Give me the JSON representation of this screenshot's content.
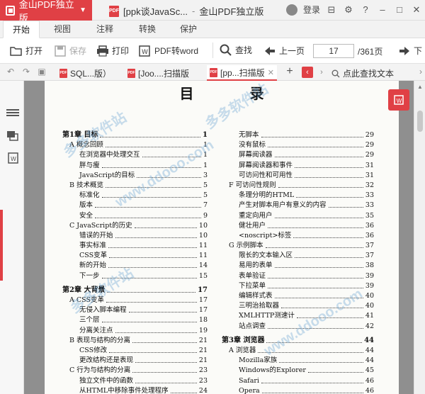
{
  "app": {
    "name": "金山PDF独立版",
    "doc_title": "[ppk谈JavaSc...",
    "window_title": "金山PDF独立版",
    "login": "登录"
  },
  "menu": [
    "开始",
    "视图",
    "注释",
    "转换",
    "保护"
  ],
  "toolbar": {
    "open": "打开",
    "save": "保存",
    "print": "打印",
    "pdf_to_word": "PDF转word",
    "find": "查找",
    "prev": "上一页",
    "page_current": "17",
    "page_total": "/361页",
    "next": "下"
  },
  "doc_tabs": [
    {
      "label": "SQL...版）"
    },
    {
      "label": "[Joo....扫描版"
    },
    {
      "label": "[pp...扫描版"
    }
  ],
  "click_find_text": "点此查找文本",
  "page": {
    "title": "目 录",
    "left_column": [
      {
        "text": "第1章  目标",
        "page": "1",
        "level": 0
      },
      {
        "text": "A  概念回顾",
        "page": "1",
        "level": 1
      },
      {
        "text": "在浏览器中处理交互",
        "page": "1",
        "level": 2
      },
      {
        "text": "胖与瘦",
        "page": "1",
        "level": 2
      },
      {
        "text": "JavaScript的目标",
        "page": "3",
        "level": 2
      },
      {
        "text": "B  技术概览",
        "page": "5",
        "level": 1
      },
      {
        "text": "标准化",
        "page": "5",
        "level": 2
      },
      {
        "text": "版本",
        "page": "7",
        "level": 2
      },
      {
        "text": "安全",
        "page": "9",
        "level": 2
      },
      {
        "text": "C  JavaScript的历史",
        "page": "10",
        "level": 1
      },
      {
        "text": "错误的开始",
        "page": "10",
        "level": 2
      },
      {
        "text": "事实标准",
        "page": "11",
        "level": 2
      },
      {
        "text": "CSS变革",
        "page": "11",
        "level": 2
      },
      {
        "text": "新的开始",
        "page": "14",
        "level": 2
      },
      {
        "text": "下一步",
        "page": "15",
        "level": 2
      },
      {
        "text": "第2章  大背景",
        "page": "17",
        "level": 0
      },
      {
        "text": "A  CSS变革",
        "page": "17",
        "level": 1
      },
      {
        "text": "无侵入脚本编程",
        "page": "17",
        "level": 2
      },
      {
        "text": "三个层",
        "page": "18",
        "level": 2
      },
      {
        "text": "分离关注点",
        "page": "19",
        "level": 2
      },
      {
        "text": "B  表现与结构的分离",
        "page": "21",
        "level": 1
      },
      {
        "text": "CSS修改",
        "page": "21",
        "level": 2
      },
      {
        "text": "更改结构还是表现",
        "page": "21",
        "level": 2
      },
      {
        "text": "C  行为与结构的分离",
        "page": "23",
        "level": 1
      },
      {
        "text": "独立文件中的函数",
        "page": "23",
        "level": 2
      },
      {
        "text": "从HTML中移除事件处理程序",
        "page": "24",
        "level": 2
      }
    ],
    "right_column": [
      {
        "text": "无脚本",
        "page": "29",
        "level": 2
      },
      {
        "text": "没有鼠标",
        "page": "29",
        "level": 2
      },
      {
        "text": "屏幕阅读器",
        "page": "29",
        "level": 2
      },
      {
        "text": "屏幕阅读器和事件",
        "page": "31",
        "level": 2
      },
      {
        "text": "可访问性和可用性",
        "page": "31",
        "level": 2
      },
      {
        "text": "F  可访问性规则",
        "page": "32",
        "level": 1
      },
      {
        "text": "条理分明的HTML",
        "page": "33",
        "level": 2
      },
      {
        "text": "产生对脚本用户有意义的内容",
        "page": "33",
        "level": 2
      },
      {
        "text": "重定向用户",
        "page": "35",
        "level": 2
      },
      {
        "text": "健壮用户",
        "page": "36",
        "level": 2
      },
      {
        "text": "<noscript>标签",
        "page": "36",
        "level": 2
      },
      {
        "text": "G  示例脚本",
        "page": "37",
        "level": 1
      },
      {
        "text": "限长的文本输入区",
        "page": "37",
        "level": 2
      },
      {
        "text": "易用的表单",
        "page": "38",
        "level": 2
      },
      {
        "text": "表单验证",
        "page": "39",
        "level": 2
      },
      {
        "text": "下拉菜单",
        "page": "39",
        "level": 2
      },
      {
        "text": "编辑样式表",
        "page": "40",
        "level": 2
      },
      {
        "text": "三明治拾取器",
        "page": "40",
        "level": 2
      },
      {
        "text": "XMLHTTP测速计",
        "page": "41",
        "level": 2
      },
      {
        "text": "站点调查",
        "page": "42",
        "level": 2
      },
      {
        "text": "第3章  浏览器",
        "page": "44",
        "level": 0
      },
      {
        "text": "A  浏览器",
        "page": "44",
        "level": 1
      },
      {
        "text": "Mozilla家族",
        "page": "44",
        "level": 2
      },
      {
        "text": "Windows的Explorer",
        "page": "45",
        "level": 2
      },
      {
        "text": "Safari",
        "page": "46",
        "level": 2
      },
      {
        "text": "Opera",
        "page": "46",
        "level": 2
      }
    ]
  },
  "watermark": "www.ddooo.com",
  "watermark_cn": "多多软件站"
}
